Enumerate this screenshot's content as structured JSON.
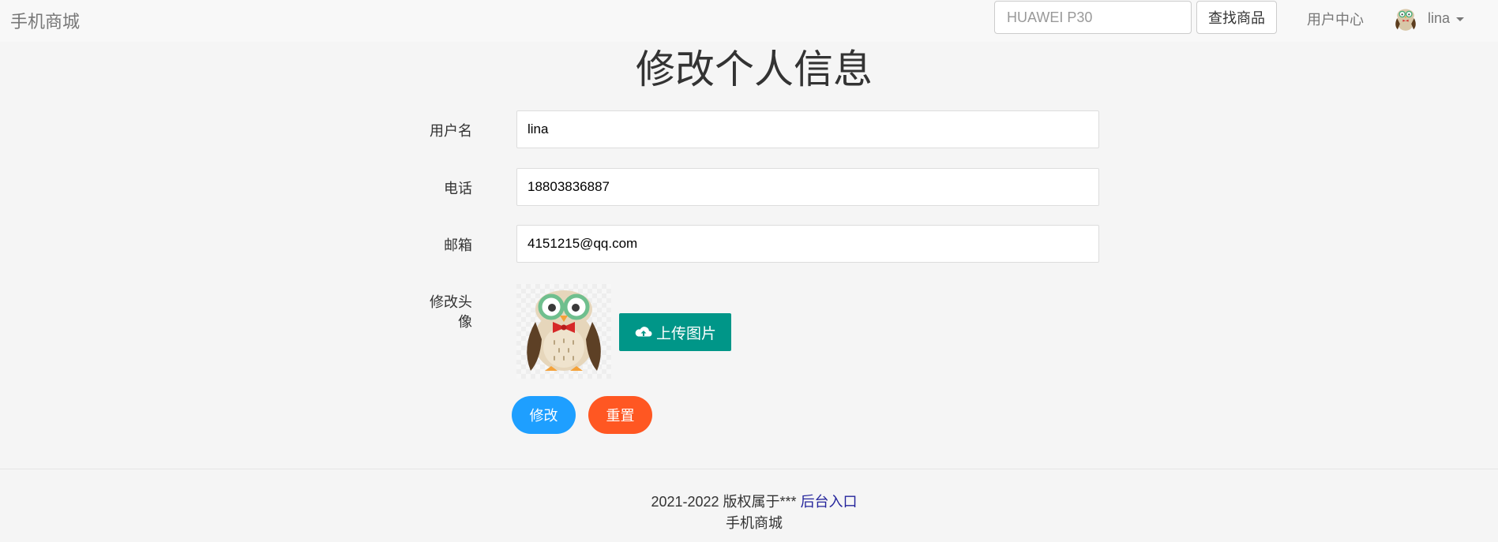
{
  "navbar": {
    "brand": "手机商城",
    "search_placeholder": "HUAWEI P30",
    "search_button": "查找商品",
    "user_center": "用户中心",
    "username": "lina"
  },
  "page": {
    "title": "修改个人信息"
  },
  "form": {
    "username_label": "用户名",
    "username_value": "lina",
    "phone_label": "电话",
    "phone_value": "18803836887",
    "email_label": "邮箱",
    "email_value": "4151215@qq.com",
    "avatar_label_line1": "修改头",
    "avatar_label_line2": "像",
    "upload_button": "上传图片",
    "submit_button": "修改",
    "reset_button": "重置"
  },
  "footer": {
    "copyright": "2021-2022 版权属于***",
    "admin_link": "后台入口",
    "site_name": "手机商城"
  },
  "colors": {
    "upload": "#009688",
    "submit": "#1e9fff",
    "reset": "#ff5722"
  }
}
